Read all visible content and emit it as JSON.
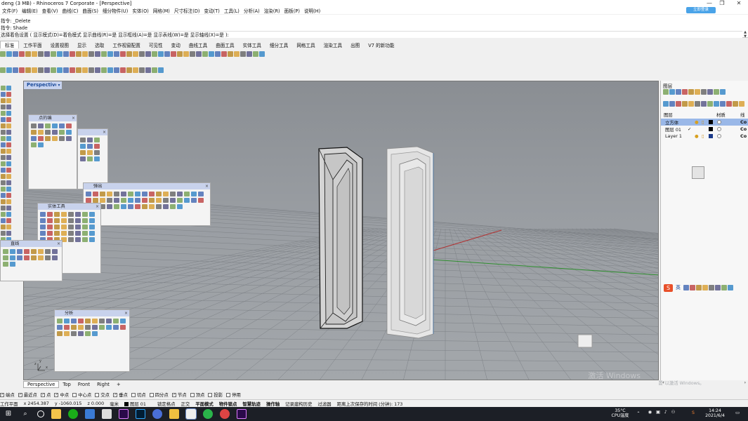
{
  "window": {
    "title": "deng (3 MB) - Rhinoceros 7 Corporate - [Perspective]",
    "minimize": "—",
    "maximize": "❐",
    "close": "✕",
    "login": "立即登录"
  },
  "menu": [
    "文件(F)",
    "编辑(E)",
    "查看(V)",
    "曲线(C)",
    "曲面(S)",
    "细分物件(U)",
    "实体(O)",
    "网格(M)",
    "尺寸标注(D)",
    "变动(T)",
    "工具(L)",
    "分析(A)",
    "渲染(R)",
    "面板(P)",
    "说明(H)"
  ],
  "command": {
    "history": [
      "指令: _Delete",
      "指令: Shade"
    ],
    "prompt": "选择着色设置 ( 显示模式(D)=着色模式  显示曲线(R)=是  显示框线(A)=是  显示表线(W)=是  显示轴线(X)=是 ):"
  },
  "tabs": [
    "标准",
    "工作平面",
    "设置视图",
    "显示",
    "选取",
    "工作视窗配置",
    "可见性",
    "变动",
    "曲线工具",
    "曲面工具",
    "实体工具",
    "细分工具",
    "网格工具",
    "渲染工具",
    "出图",
    "V7 的新功能"
  ],
  "viewport": {
    "label": "Perspective",
    "dropdown": "▾",
    "axis_x": "x",
    "axis_y": "y",
    "axis_z": "z"
  },
  "palettes": [
    {
      "title": "点的编"
    },
    {
      "title": "弹出"
    },
    {
      "title": "实体工具"
    },
    {
      "title": "直线"
    },
    {
      "title": "分析"
    }
  ],
  "palette_close": "×",
  "view_tabs": [
    "Perspective",
    "Top",
    "Front",
    "Right",
    "+"
  ],
  "osnap": [
    {
      "label": "端点",
      "checked": true
    },
    {
      "label": "最近点",
      "checked": true
    },
    {
      "label": "点",
      "checked": true
    },
    {
      "label": "中点",
      "checked": true
    },
    {
      "label": "中心点",
      "checked": false
    },
    {
      "label": "交点",
      "checked": false
    },
    {
      "label": "垂点",
      "checked": true
    },
    {
      "label": "切点",
      "checked": false
    },
    {
      "label": "四分点",
      "checked": false
    },
    {
      "label": "节点",
      "checked": true
    },
    {
      "label": "顶点",
      "checked": false
    },
    {
      "label": "投影",
      "checked": false
    },
    {
      "label": "停用",
      "checked": false
    }
  ],
  "status": {
    "cplane": "工作平面",
    "x": "x 2454.387",
    "y": "y -1060.015",
    "z": "z 0.000",
    "unit": "毫米",
    "layer": "图层 01",
    "toggles": [
      "锁定格点",
      "正交"
    ],
    "bold_toggles": [
      "平面模式",
      "物件锁点",
      "智慧轨迹",
      "操作轴"
    ],
    "history": "记录建构历史",
    "filter": "过滤器",
    "autosave": "距离上次保存的时间 (分钟): 173"
  },
  "watermark": {
    "line1": "激活 Windows",
    "line2": "转到\"设置\"以激活 Windows。"
  },
  "layers_panel": {
    "title": "图层",
    "col_layer": "图层",
    "col_material": "材质",
    "col_linetype": "线型",
    "rows": [
      {
        "name": "立方体",
        "current": false,
        "selected": true,
        "color": "#000000",
        "end": "Co"
      },
      {
        "name": "图层 01",
        "current": true,
        "selected": false,
        "color": "#000000",
        "end": "Co"
      },
      {
        "name": "Layer 1",
        "current": false,
        "selected": false,
        "color": "#1a3a8a",
        "end": "Co"
      }
    ],
    "current_mark": "✓"
  },
  "ime": {
    "lang": "英"
  },
  "tray": {
    "temp": "35°C",
    "temp_label": "CPU温度",
    "time": "14:24",
    "date": "2021/6/4"
  },
  "colors": {
    "axis_red": "#b03030",
    "axis_green": "#2f8f2f",
    "grid": "#7d8186",
    "palette_header": "#c8d2ec",
    "selected_layer": "#9ab8e8"
  }
}
